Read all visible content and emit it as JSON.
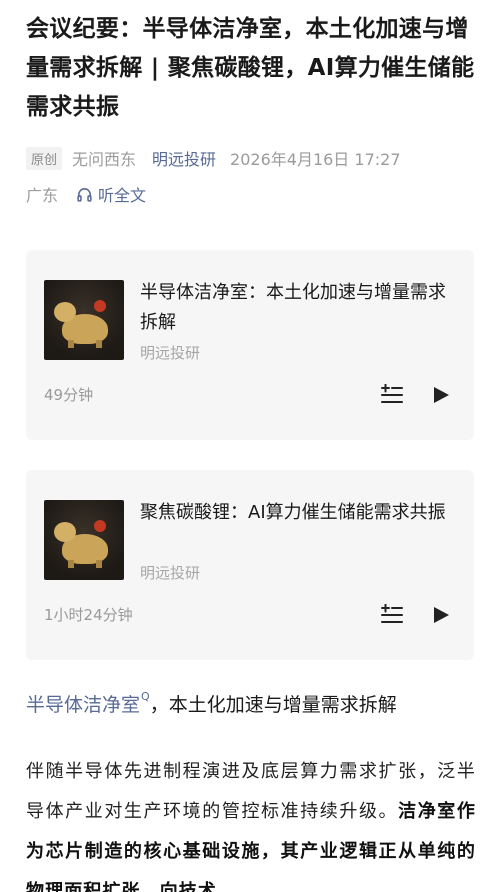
{
  "article": {
    "title": "会议纪要：半导体洁净室，本土化加速与增量需求拆解 | 聚焦碳酸锂，AI算力催生储能需求共振",
    "badge": "原创",
    "author": "无问西东",
    "account": "明远投研",
    "datetime": "2026年4月16日 17:27",
    "location": "广东",
    "listen_label": "听全文"
  },
  "audio_cards": [
    {
      "title": "半导体洁净室：本土化加速与增量需求拆解",
      "source": "明远投研",
      "duration": "49分钟",
      "thumb_icon": "golden-pig-figurine"
    },
    {
      "title": "聚焦碳酸锂：AI算力催生储能需求共振",
      "source": "明远投研",
      "duration": "1小时24分钟",
      "thumb_icon": "golden-pig-figurine"
    }
  ],
  "section": {
    "link_text": "半导体洁净室",
    "rest_text": "，本土化加速与增量需求拆解"
  },
  "body": {
    "normal": "伴随半导体先进制程演进及底层算力需求扩张，泛半导体产业对生产环境的管控标准持续升级。",
    "bold": "洁净室作为芯片制造的核心基础设施，其产业逻辑正从单纯的物理面积扩张，向技术"
  },
  "colors": {
    "link": "#576b95",
    "card_bg": "#f6f6f6",
    "meta_gray": "#9b9b9b"
  }
}
